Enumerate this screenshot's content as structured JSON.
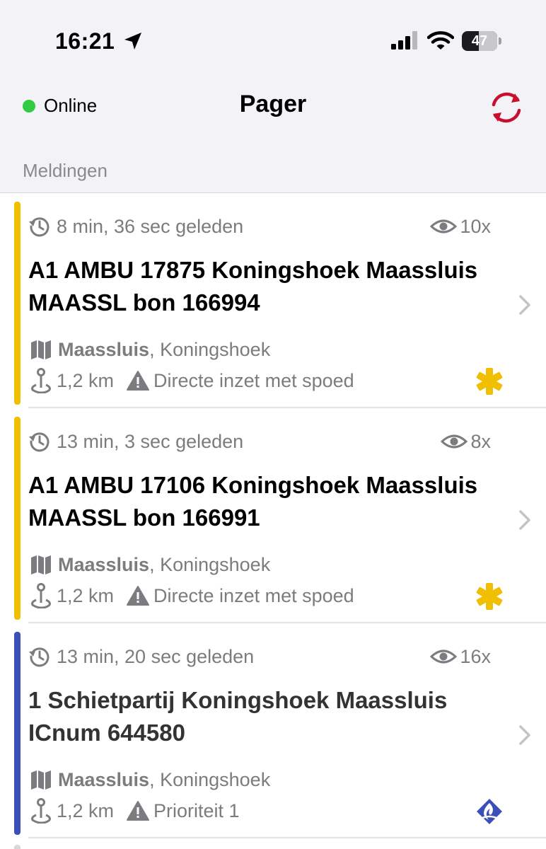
{
  "status_bar": {
    "time": "16:21",
    "battery": "47"
  },
  "nav": {
    "online_label": "Online",
    "title": "Pager"
  },
  "section": {
    "header": "Meldingen"
  },
  "colors": {
    "ambulance": "#f0c000",
    "police": "#3a4fb8",
    "online": "#2ecc40",
    "refresh": "#c8102e"
  },
  "notifications": [
    {
      "time_ago": "8 min, 36 sec geleden",
      "views": "10x",
      "title": "A1 AMBU 17875 Koningshoek Maassluis MAASSL bon 166994",
      "city": "Maassluis",
      "area": ", Koningshoek",
      "distance": "1,2 km",
      "priority": "Directe inzet met spoed",
      "service_icon": "ambulance-star-of-life-icon"
    },
    {
      "time_ago": "13 min, 3 sec geleden",
      "views": "8x",
      "title": "A1 AMBU 17106 Koningshoek Maassluis MAASSL bon 166991",
      "city": "Maassluis",
      "area": ", Koningshoek",
      "distance": "1,2 km",
      "priority": "Directe inzet met spoed",
      "service_icon": "ambulance-star-of-life-icon"
    },
    {
      "time_ago": "13 min, 20 sec geleden",
      "views": "16x",
      "title": "1 Schietpartij Koningshoek Maassluis ICnum 644580",
      "city": "Maassluis",
      "area": ", Koningshoek",
      "distance": "1,2 km",
      "priority": "Prioriteit 1",
      "service_icon": "police-flame-icon"
    }
  ]
}
